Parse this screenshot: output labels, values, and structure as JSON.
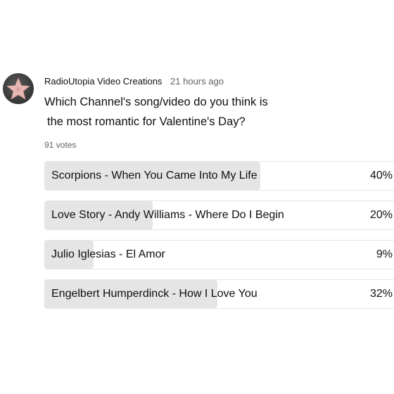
{
  "post": {
    "channel_name": "RadioUtopia Video Creations",
    "time_ago": "21 hours ago",
    "question_line1": "Which Channel's song/video do you think is",
    "question_line2": "the most romantic for Valentine's Day?",
    "votes": "91 votes",
    "avatar_icon": "star-icon",
    "avatar_colors": {
      "star": "#e7b7b2",
      "background": "#3d3d3d"
    }
  },
  "poll": {
    "options": [
      {
        "label": "Scorpions - When You Came Into My Life",
        "percent_text": "40%",
        "percent": 40
      },
      {
        "label": "Love Story - Andy Williams - Where Do I Begin",
        "percent_text": "20%",
        "percent": 20
      },
      {
        "label": "Julio Iglesias - El Amor",
        "percent_text": "9%",
        "percent": 9
      },
      {
        "label": "Engelbert Humperdinck - How I Love You",
        "percent_text": "32%",
        "percent": 32
      }
    ],
    "fill_color": "#e5e5e5",
    "border_color": "#e5e5e5"
  }
}
